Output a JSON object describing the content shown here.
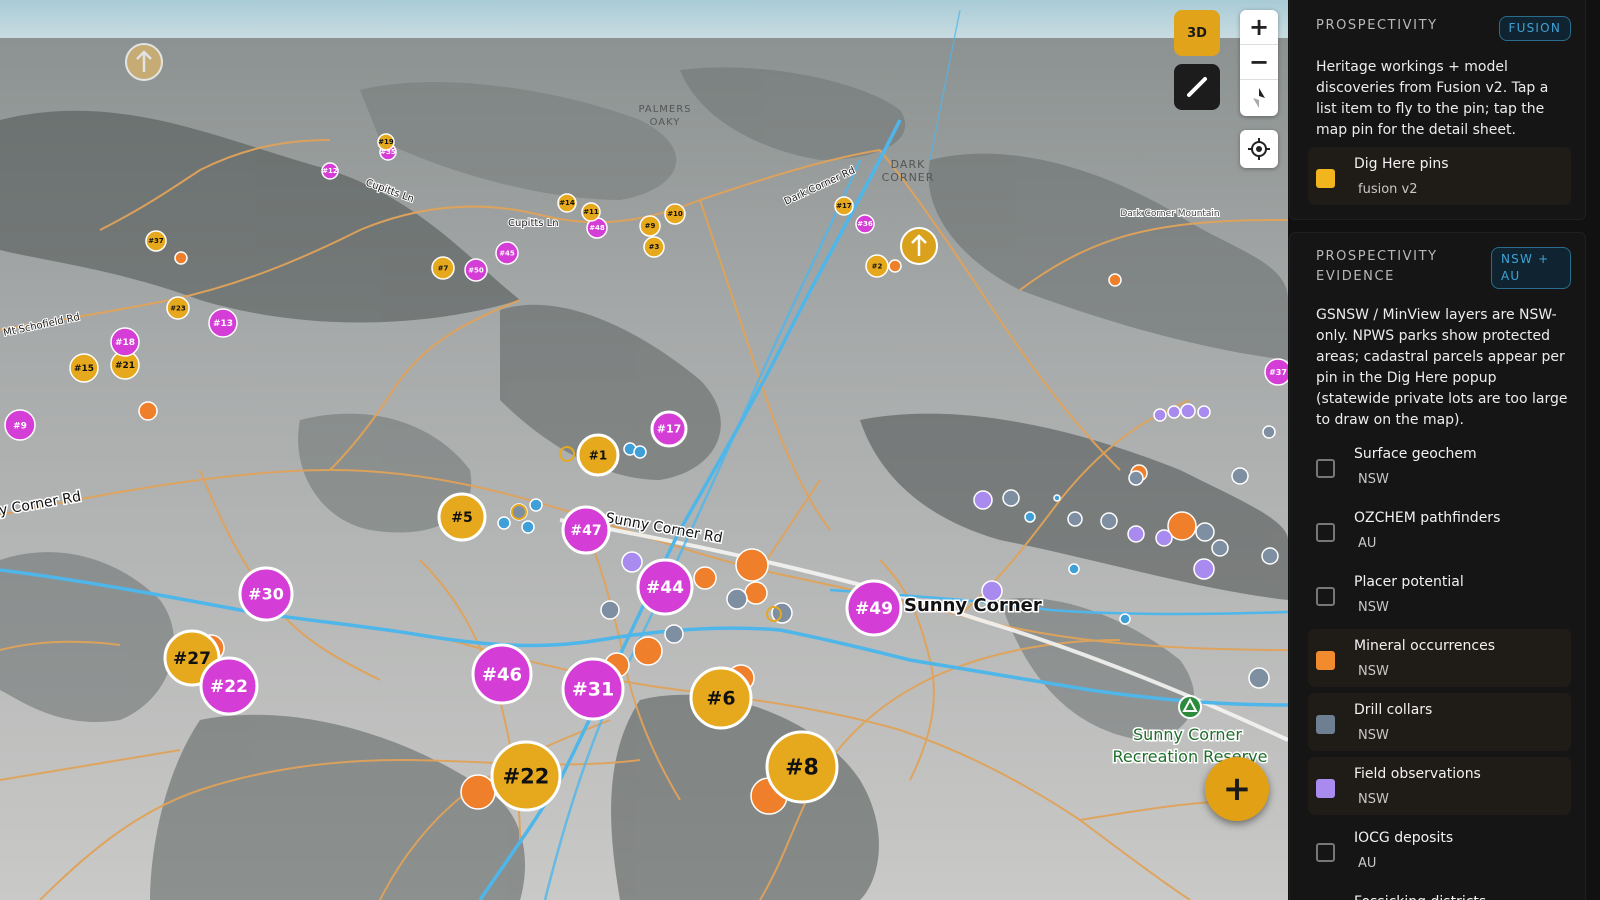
{
  "map": {
    "colors": {
      "pin_yellow": "#e6a91e",
      "pin_magenta": "#d43ed6",
      "pin_orange": "#ef7f2a",
      "road": "#e0a35a",
      "stream": "#4fb6ea"
    },
    "pins": [
      {
        "label": "#1",
        "color": "yellow"
      },
      {
        "label": "#5",
        "color": "yellow"
      },
      {
        "label": "#47",
        "color": "magenta"
      },
      {
        "label": "#44",
        "color": "magenta"
      },
      {
        "label": "#49",
        "color": "magenta"
      },
      {
        "label": "#30",
        "color": "magenta"
      },
      {
        "label": "#27",
        "color": "yellow"
      },
      {
        "label": "#22",
        "color": "magenta"
      },
      {
        "label": "#46",
        "color": "magenta"
      },
      {
        "label": "#31",
        "color": "magenta"
      },
      {
        "label": "#6",
        "color": "yellow"
      },
      {
        "label": "#22",
        "color": "yellow"
      },
      {
        "label": "#8",
        "color": "yellow"
      },
      {
        "label": "#17",
        "color": "magenta"
      },
      {
        "label": "#9",
        "color": "magenta"
      },
      {
        "label": "#15",
        "color": "yellow"
      },
      {
        "label": "#21",
        "color": "yellow"
      },
      {
        "label": "#18",
        "color": "magenta"
      },
      {
        "label": "#13",
        "color": "magenta"
      },
      {
        "label": "#23",
        "color": "yellow"
      },
      {
        "label": "#7",
        "color": "yellow"
      },
      {
        "label": "#50",
        "color": "magenta"
      },
      {
        "label": "#45",
        "color": "magenta"
      },
      {
        "label": "#37",
        "color": "yellow"
      },
      {
        "label": "#3",
        "color": "yellow"
      },
      {
        "label": "#9",
        "color": "yellow"
      },
      {
        "label": "#48",
        "color": "magenta"
      },
      {
        "label": "#10",
        "color": "yellow"
      },
      {
        "label": "#11",
        "color": "yellow"
      },
      {
        "label": "#14",
        "color": "yellow"
      },
      {
        "label": "#36",
        "color": "magenta"
      },
      {
        "label": "#17",
        "color": "yellow"
      },
      {
        "label": "#37",
        "color": "magenta"
      },
      {
        "label": "#12",
        "color": "magenta"
      },
      {
        "label": "#35",
        "color": "magenta"
      },
      {
        "label": "#19",
        "color": "yellow"
      },
      {
        "label": "#2",
        "color": "yellow"
      }
    ],
    "place_labels": {
      "sunny_corner": "Sunny Corner",
      "recreation_reserve": "Sunny Corner Recreation Reserve",
      "dark_corner": "DARK CORNER",
      "palmers_oaky": "PALMERS OAKY",
      "dark_corner_mountain": "Dark Corner Mountain"
    },
    "road_labels": {
      "sunny_corner_rd": "Sunny Corner Rd",
      "corner_rd": "y Corner Rd",
      "cupitts_ln": "Cupitts Ln",
      "cupitts_ln_2": "Cupitts Ln",
      "dark_corner_rd": "Dark Corner Rd",
      "schofield_rd": "Mt Schofield Rd"
    },
    "controls": {
      "mode_3d": "3D",
      "zoom_in": "+",
      "zoom_out": "−",
      "fab": "+"
    }
  },
  "panel": {
    "fusion": {
      "title": "PROSPECTIVITY",
      "badge": "FUSION",
      "description": "Heritage workings + model discoveries from Fusion v2. Tap a list item to fly to the pin; tap the map pin for the detail sheet.",
      "layer": {
        "name": "Dig Here pins",
        "sub": "fusion v2",
        "on": true,
        "color": "#f2b51d"
      }
    },
    "evidence": {
      "title": "PROSPECTIVITY EVIDENCE",
      "badge": "NSW + AU",
      "description": "GSNSW / MinView layers are NSW-only. NPWS parks show protected areas; cadastral parcels appear per pin in the Dig Here popup (statewide private lots are too large to draw on the map).",
      "layers": [
        {
          "name": "Surface geochem",
          "sub": "NSW",
          "on": false,
          "color": ""
        },
        {
          "name": "OZCHEM pathfinders",
          "sub": "AU",
          "on": false,
          "color": ""
        },
        {
          "name": "Placer potential",
          "sub": "NSW",
          "on": false,
          "color": ""
        },
        {
          "name": "Mineral occurrences",
          "sub": "NSW",
          "on": true,
          "color": "#f28a2e"
        },
        {
          "name": "Drill collars",
          "sub": "NSW",
          "on": true,
          "color": "#6e7f92"
        },
        {
          "name": "Field observations",
          "sub": "NSW",
          "on": true,
          "color": "#a98bf0"
        },
        {
          "name": "IOCG deposits",
          "sub": "AU",
          "on": false,
          "color": ""
        },
        {
          "name": "Fossicking districts",
          "sub": "",
          "on": false,
          "color": ""
        }
      ]
    }
  }
}
